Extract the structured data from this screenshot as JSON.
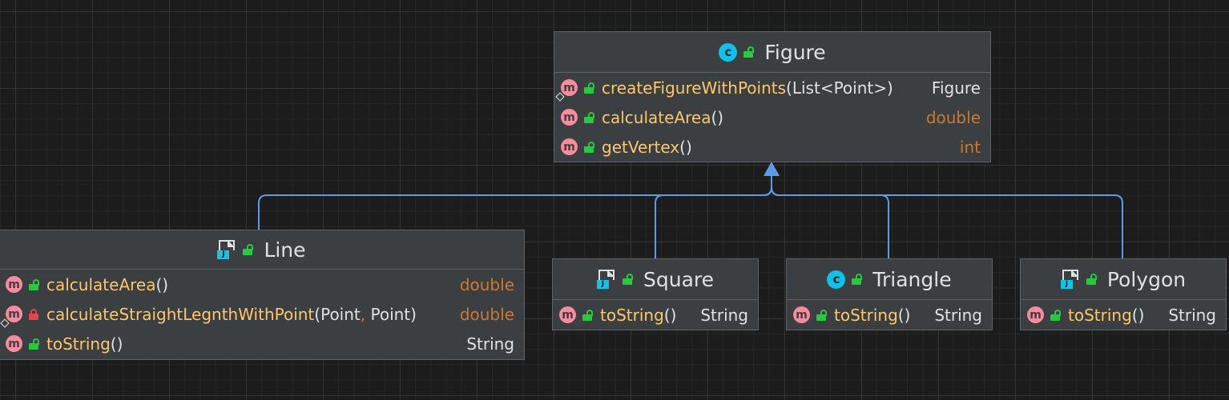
{
  "diagram": {
    "classes": {
      "figure": {
        "name": "Figure",
        "kind": "class-icon",
        "members": [
          {
            "name": "createFigureWithPoints",
            "params": [
              "List<Point>"
            ],
            "return_type": "Figure",
            "return_kind": "class",
            "static": true,
            "visibility": "public"
          },
          {
            "name": "calculateArea",
            "params": [],
            "return_type": "double",
            "return_kind": "primitive",
            "static": false,
            "visibility": "public"
          },
          {
            "name": "getVertex",
            "params": [],
            "return_type": "int",
            "return_kind": "primitive",
            "static": false,
            "visibility": "public"
          }
        ]
      },
      "line": {
        "name": "Line",
        "kind": "java-file-icon",
        "members": [
          {
            "name": "calculateArea",
            "params": [],
            "return_type": "double",
            "return_kind": "primitive",
            "static": false,
            "visibility": "public"
          },
          {
            "name": "calculateStraightLegnthWithPoint",
            "params": [
              "Point",
              "Point"
            ],
            "return_type": "double",
            "return_kind": "primitive",
            "static": true,
            "visibility": "private"
          },
          {
            "name": "toString",
            "params": [],
            "return_type": "String",
            "return_kind": "class",
            "static": false,
            "visibility": "public"
          }
        ]
      },
      "square": {
        "name": "Square",
        "kind": "java-file-icon",
        "members": [
          {
            "name": "toString",
            "params": [],
            "return_type": "String",
            "return_kind": "class",
            "static": false,
            "visibility": "public"
          }
        ]
      },
      "triangle": {
        "name": "Triangle",
        "kind": "class-icon",
        "members": [
          {
            "name": "toString",
            "params": [],
            "return_type": "String",
            "return_kind": "class",
            "static": false,
            "visibility": "public"
          }
        ]
      },
      "polygon": {
        "name": "Polygon",
        "kind": "java-file-icon",
        "members": [
          {
            "name": "toString",
            "params": [],
            "return_type": "String",
            "return_kind": "class",
            "static": false,
            "visibility": "public"
          }
        ]
      }
    },
    "inheritance": [
      {
        "from": "line",
        "to": "figure"
      },
      {
        "from": "square",
        "to": "figure"
      },
      {
        "from": "triangle",
        "to": "figure"
      },
      {
        "from": "polygon",
        "to": "figure"
      }
    ],
    "method_icon_letter": "m",
    "class_icon_letter": "c",
    "java_icon_letter": "J",
    "colors": {
      "background": "#1c1c1c",
      "node_background": "#3c3f41",
      "method_name": "#ffc66d",
      "primitive_type": "#cc7832",
      "edge": "#5c9ce6",
      "method_icon": "#f98b9e",
      "class_icon": "#10c0e6",
      "public_lock": "#27c93f",
      "private_lock": "#e8414f"
    }
  }
}
